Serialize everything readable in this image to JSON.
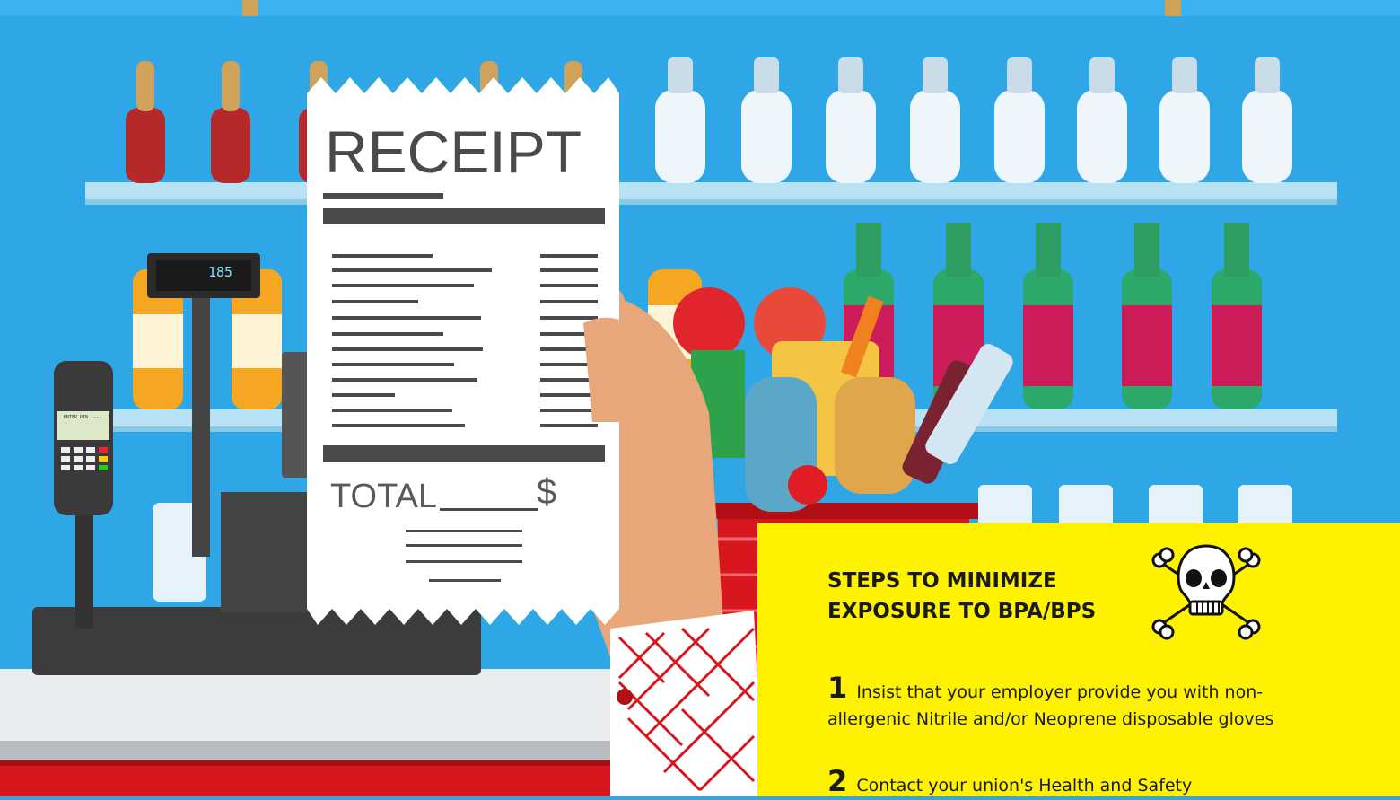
{
  "illustration": {
    "receipt": {
      "title": "RECEIPT",
      "total_label": "TOTAL",
      "currency_symbol": "$"
    },
    "register_display": "185",
    "card_terminal_text": "ENTER PIN ----",
    "colors": {
      "sky": "#2fa6e6",
      "counter_red": "#d8161e",
      "panel_yellow": "#fff200"
    }
  },
  "info_panel": {
    "title": "STEPS TO MINIMIZE EXPOSURE TO BPA/BPS",
    "icon": "skull-and-crossbones-icon",
    "steps": [
      {
        "number": "1",
        "text": "Insist that your employer provide you with non-allergenic Nitrile and/or Neoprene disposable gloves"
      },
      {
        "number": "2",
        "text": "Contact your union's Health and Safety"
      }
    ]
  }
}
